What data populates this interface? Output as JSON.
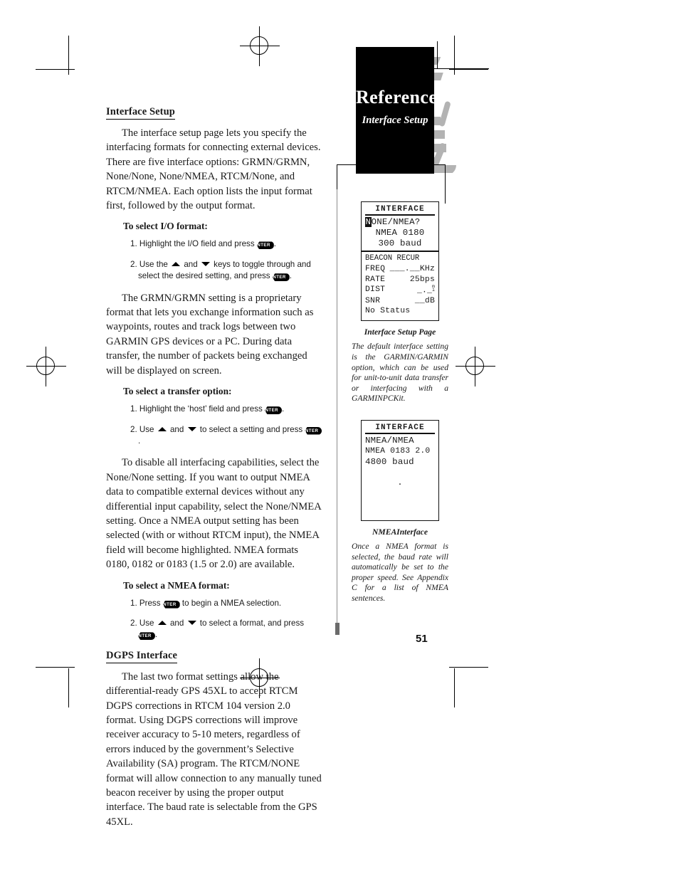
{
  "page": {
    "number": "51",
    "header": {
      "title": "Reference",
      "subtitle": "Interface Setup"
    }
  },
  "main": {
    "section1": {
      "heading": "Interface Setup",
      "paragraph": "The interface setup page lets you specify the interfacing formats for connecting external devices. There are five interface options: GRMN/GRMN, None/None, None/NMEA, RTCM/None, and RTCM/NMEA. Each option lists the input format first, followed by the output format."
    },
    "proc1": {
      "heading": "To select I/O format:",
      "step1_a": "1. Highlight the I/O field and press",
      "step1_b": ".",
      "step2_a": "2. Use the",
      "step2_b": "and",
      "step2_c": "keys to toggle through and select the desired setting, and press",
      "step2_d": "."
    },
    "paragraph2": "The GRMN/GRMN setting is a proprietary format that lets you exchange information such as waypoints, routes and track logs between two GARMIN GPS devices or a PC. During data transfer, the number of packets being exchanged will be displayed on screen.",
    "proc2": {
      "heading": "To select a transfer option:",
      "step1_a": "1. Highlight the ‘host’ field and press",
      "step1_b": ".",
      "step2_a": "2. Use",
      "step2_b": "and",
      "step2_c": "to select a setting and press",
      "step2_d": "."
    },
    "paragraph3": "To disable all interfacing capabilities, select the None/None setting. If you want to output NMEA data to compatible external devices without any differential input capability, select the None/NMEA setting. Once a NMEA output setting has been selected (with or without RTCM input), the NMEA field will become highlighted. NMEA formats 0180, 0182 or 0183 (1.5 or 2.0) are available.",
    "proc3": {
      "heading": "To select a NMEA format:",
      "step1_a": "1. Press",
      "step1_b": "to begin a NMEA selection.",
      "step2_a": "2. Use",
      "step2_b": "and",
      "step2_c": "to select a format, and press",
      "step2_d": "."
    },
    "section2": {
      "heading": "DGPS Interface",
      "paragraph": "The last two format settings allow the differential-ready GPS 45XL to accept RTCM DGPS corrections in RTCM 104 version 2.0 format. Using DGPS corrections will improve receiver accuracy to 5-10 meters, regardless of errors induced by the government’s Selective Availability (SA) program. The RTCM/NONE format will allow connection to any manually tuned beacon receiver by using the proper output interface. The baud rate is selectable from the GPS 45XL."
    },
    "enter_key_label": "ENTER"
  },
  "sidebar": {
    "figure1": {
      "screen": {
        "title": "INTERFACE",
        "line_io_highlight": "N",
        "line_io_rest": "ONE/NMEA?",
        "line_nmea": "NMEA 0180",
        "line_baud": "300 baud",
        "beacon_header": "BEACON RECUR",
        "rows": [
          {
            "label": "FREQ",
            "value": "___.__",
            "unit": "KHz"
          },
          {
            "label": "RATE",
            "value": "25",
            "unit": "bps"
          },
          {
            "label": "DIST",
            "value": "_._",
            "unit_top": "m",
            "unit_bottom": "i"
          },
          {
            "label": "SNR",
            "value": "__",
            "unit": "dB"
          }
        ],
        "status": "No Status"
      },
      "caption_title": "Interface Setup Page",
      "caption_body": "The default interface setting is the GARMIN/GARMIN option, which can be used for unit-to-unit data transfer or interfacing with a GARMINPCKit."
    },
    "figure2": {
      "screen": {
        "title": "INTERFACE",
        "line_io": "NMEA/NMEA",
        "line_nmea": "NMEA 0183 2.0",
        "line_baud": "4800 baud",
        "dot": "."
      },
      "caption_title": "NMEAInterface",
      "caption_body": "Once a NMEA format is selected, the baud rate will automatically be set to the proper speed. See Appendix C for a list of NMEA sentences."
    }
  }
}
